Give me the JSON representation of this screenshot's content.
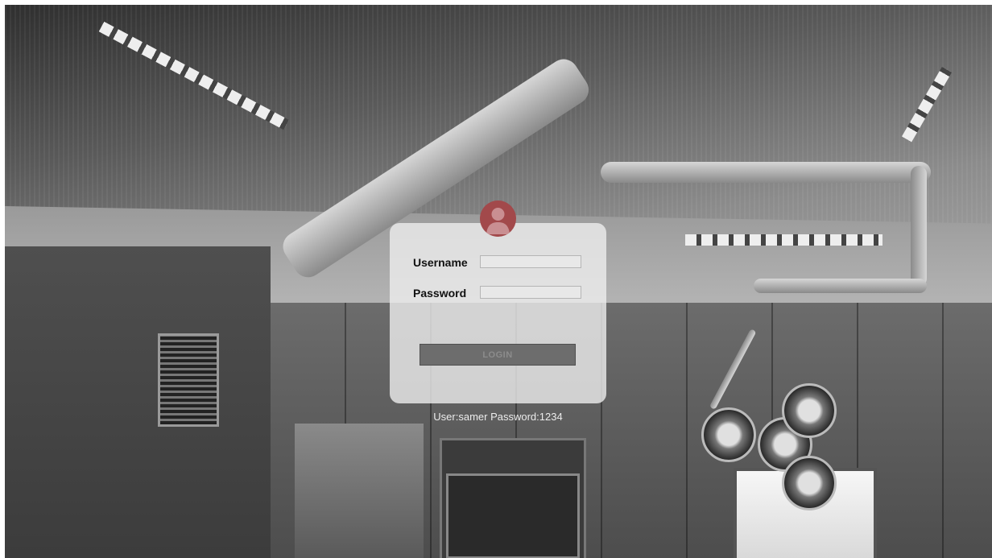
{
  "login": {
    "avatar_icon": "user-avatar-icon",
    "username_label": "Username",
    "username_value": "",
    "password_label": "Password",
    "password_value": "",
    "login_label": "LOGIN",
    "hint_text": "User:samer Password:1234"
  },
  "colors": {
    "avatar_bg": "#a2494b",
    "panel_bg": "rgba(238,238,238,0.80)",
    "button_bg": "#6d6d6d",
    "button_text": "#8c8c8c"
  }
}
